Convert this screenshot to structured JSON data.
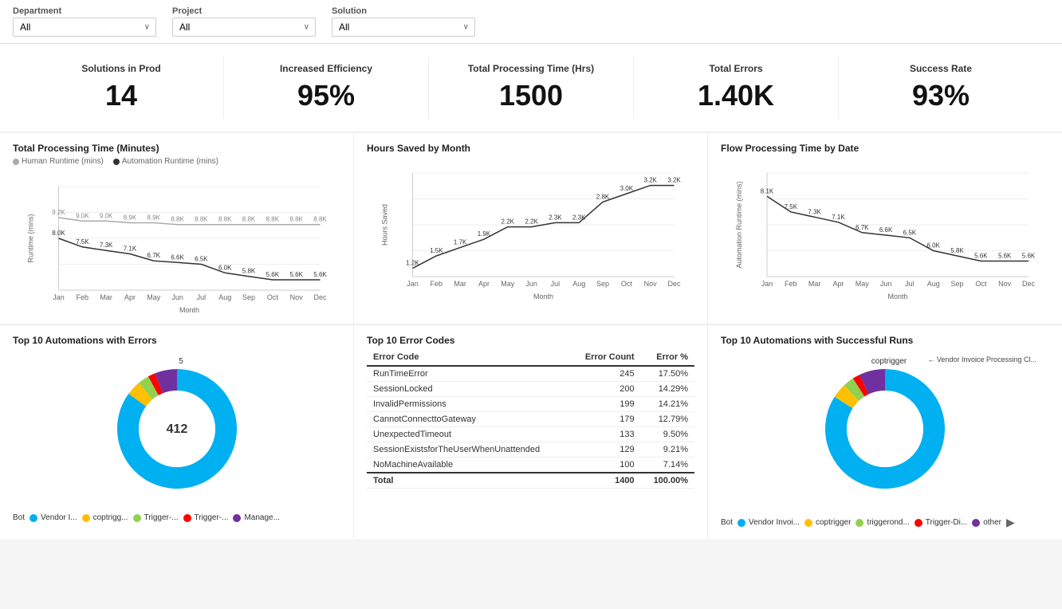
{
  "filters": {
    "department": {
      "label": "Department",
      "value": "All"
    },
    "project": {
      "label": "Project",
      "value": "All"
    },
    "solution": {
      "label": "Solution",
      "value": "All"
    }
  },
  "kpis": [
    {
      "label": "Solutions in Prod",
      "value": "14"
    },
    {
      "label": "Increased Efficiency",
      "value": "95%"
    },
    {
      "label": "Total Processing Time (Hrs)",
      "value": "1500"
    },
    {
      "label": "Total Errors",
      "value": "1.40K"
    },
    {
      "label": "Success Rate",
      "value": "93%"
    }
  ],
  "charts": {
    "totalProcessingTime": {
      "title": "Total Processing Time (Minutes)",
      "legend": [
        {
          "label": "Human Runtime (mins)",
          "color": "#aaa"
        },
        {
          "label": "Automation Runtime (mins)",
          "color": "#333"
        }
      ],
      "months": [
        "Jan",
        "Feb",
        "Mar",
        "Apr",
        "May",
        "Jun",
        "Jul",
        "Aug",
        "Sep",
        "Oct",
        "Nov",
        "Dec"
      ],
      "humanData": [
        9200,
        9000,
        9000,
        8900,
        8900,
        8800,
        8800,
        8800,
        8800,
        8800,
        8800,
        8800
      ],
      "autoData": [
        8000,
        7500,
        7300,
        7100,
        6700,
        6600,
        6500,
        6000,
        5800,
        5600,
        5600,
        5600
      ],
      "yAxisLabel": "Runtime (mins)",
      "xAxisLabel": "Month",
      "labels_human": [
        "9.2K",
        "9.0K",
        "9.0K",
        "8.9K",
        "8.9K",
        "8.8K",
        "8.8K",
        "8.8K",
        "8.8K",
        "8.8K",
        "8.8K",
        "8.8K"
      ],
      "labels_auto": [
        "8.0K",
        "7.5K",
        "7.3K",
        "7.1K",
        "6.7K",
        "6.6K",
        "6.5K",
        "6.0K",
        "5.8K",
        "5.6K",
        "5.6K",
        "5.6K"
      ],
      "yMin": 5000,
      "yMax": 11000
    },
    "hoursSaved": {
      "title": "Hours Saved by Month",
      "months": [
        "Jan",
        "Feb",
        "Mar",
        "Apr",
        "May",
        "Jun",
        "Jul",
        "Aug",
        "Sep",
        "Oct",
        "Nov",
        "Dec"
      ],
      "data": [
        1200,
        1500,
        1700,
        1900,
        2200,
        2200,
        2300,
        2300,
        2800,
        3000,
        3200,
        3200
      ],
      "labels": [
        "1.2K",
        "1.5K",
        "1.7K",
        "1.9K",
        "2.2K",
        "2.2K",
        "2.3K",
        "2.3K",
        "2.8K",
        "3.0K",
        "3.2K",
        "3.2K"
      ],
      "yAxisLabel": "Hours Saved",
      "xAxisLabel": "Month",
      "yMin": 1000,
      "yMax": 3500
    },
    "flowProcessing": {
      "title": "Flow Processing Time by Date",
      "months": [
        "Jan",
        "Feb",
        "Mar",
        "Apr",
        "May",
        "Jun",
        "Jul",
        "Aug",
        "Sep",
        "Oct",
        "Nov",
        "Dec"
      ],
      "data": [
        8100,
        7500,
        7300,
        7100,
        6700,
        6600,
        6500,
        6000,
        5800,
        5600,
        5600,
        5600
      ],
      "labels": [
        "8.1K",
        "7.5K",
        "7.3K",
        "7.1K",
        "6.7K",
        "6.6K",
        "6.5K",
        "6.0K",
        "5.8K",
        "5.6K",
        "5.6K",
        "5.6K"
      ],
      "yAxisLabel": "Automation Runtime (mins)",
      "xAxisLabel": "Month",
      "yMin": 5000,
      "yMax": 9000
    }
  },
  "errorsDonut": {
    "title": "Top 10 Automations with Errors",
    "centerLabel": "412",
    "topLabel": "5",
    "segments": [
      {
        "label": "Vendor I...",
        "color": "#00b0f0",
        "pct": 85
      },
      {
        "label": "coptrigg...",
        "color": "#ffc000",
        "pct": 4
      },
      {
        "label": "Trigger-...",
        "color": "#92d050",
        "pct": 3
      },
      {
        "label": "Trigger-...",
        "color": "#ff0000",
        "pct": 2
      },
      {
        "label": "Manage...",
        "color": "#7030a0",
        "pct": 6
      }
    ],
    "legend": [
      "Bot",
      "Vendor I...",
      "coptrigg...",
      "Trigger-...",
      "Trigger-...",
      "Manage..."
    ]
  },
  "successDonut": {
    "title": "Top 10 Automations with Successful Runs",
    "topLabel": "coptrigger",
    "segments": [
      {
        "label": "Vendor Invoi...",
        "color": "#00b0f0",
        "pct": 84
      },
      {
        "label": "coptrigger",
        "color": "#ffc000",
        "pct": 4
      },
      {
        "label": "triggerond...",
        "color": "#92d050",
        "pct": 3
      },
      {
        "label": "Trigger-Di...",
        "color": "#ff0000",
        "pct": 2
      },
      {
        "label": "other",
        "color": "#7030a0",
        "pct": 7
      }
    ],
    "legend": [
      "Bot",
      "Vendor Invoi...",
      "coptrigger",
      "triggerond...",
      "Trigger-Di..."
    ],
    "sideLabel": "Vendor Invoice Processing Cl..."
  },
  "errorCodes": {
    "title": "Top 10 Error Codes",
    "columns": [
      "Error Code",
      "Error Count",
      "Error %"
    ],
    "rows": [
      {
        "code": "RunTimeError",
        "count": "245",
        "pct": "17.50%"
      },
      {
        "code": "SessionLocked",
        "count": "200",
        "pct": "14.29%"
      },
      {
        "code": "InvalidPermissions",
        "count": "199",
        "pct": "14.21%"
      },
      {
        "code": "CannotConnecttoGateway",
        "count": "179",
        "pct": "12.79%"
      },
      {
        "code": "UnexpectedTimeout",
        "count": "133",
        "pct": "9.50%"
      },
      {
        "code": "SessionExistsforTheUserWhenUnattended",
        "count": "129",
        "pct": "9.21%"
      },
      {
        "code": "NoMachineAvailable",
        "count": "100",
        "pct": "7.14%"
      }
    ],
    "total": {
      "label": "Total",
      "count": "1400",
      "pct": "100.00%"
    }
  }
}
